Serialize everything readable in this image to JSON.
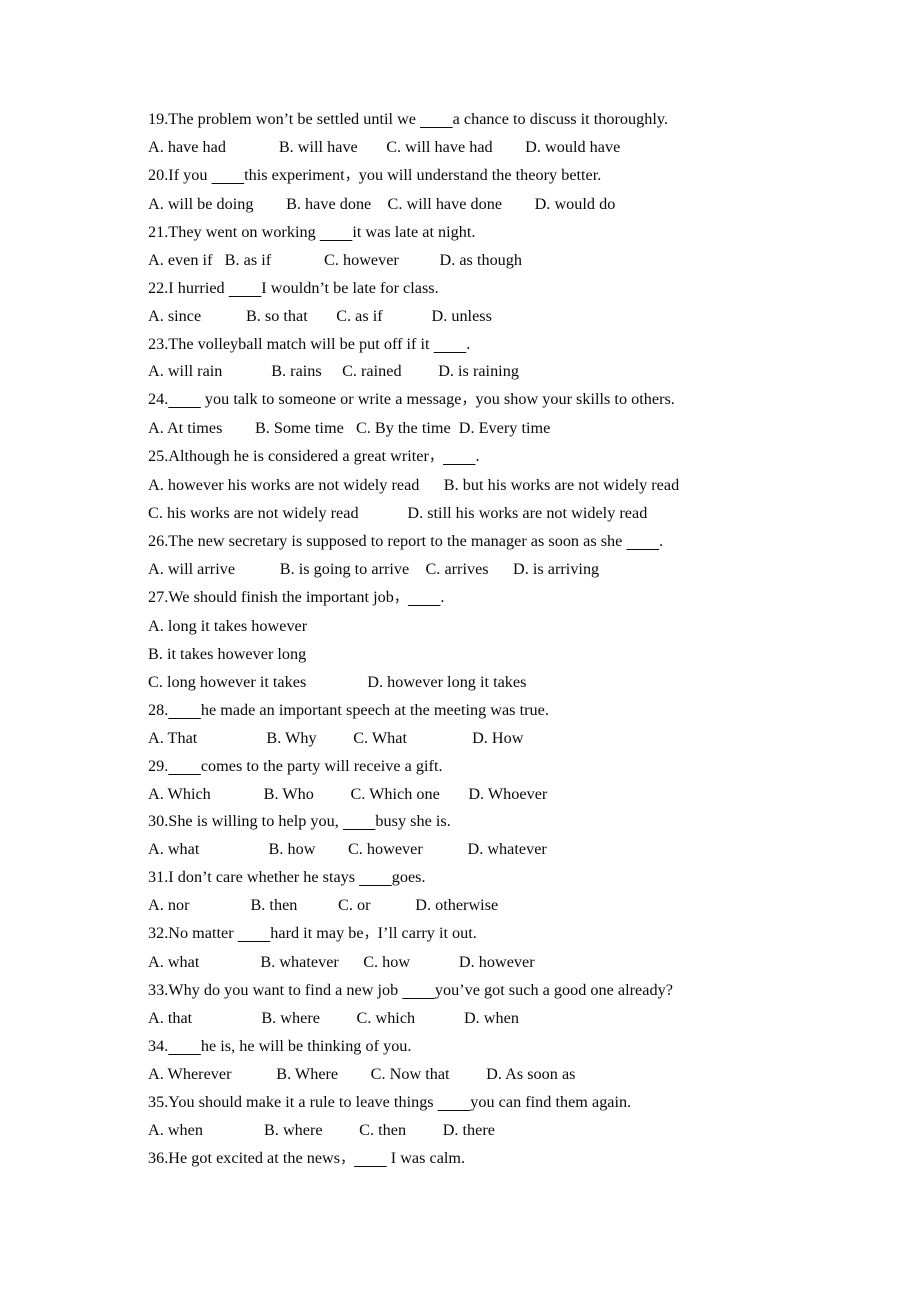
{
  "document": {
    "type": "grammar-multiple-choice-worksheet",
    "blank": "________",
    "lines": [
      {
        "id": "q19",
        "kind": "stem",
        "text": "19.The problem won’t be settled until we ________a chance to discuss it thoroughly."
      },
      {
        "id": "q19o",
        "kind": "options",
        "text": "A. have had             B. will have       C. will have had        D. would have"
      },
      {
        "id": "q20",
        "kind": "stem",
        "text": "20.If you ________this experiment，you will understand the theory better."
      },
      {
        "id": "q20o",
        "kind": "options",
        "text": "A. will be doing        B. have done    C. will have done        D. would do"
      },
      {
        "id": "q21",
        "kind": "stem",
        "text": "21.They went on working ________it was late at night."
      },
      {
        "id": "q21o",
        "kind": "options",
        "text": "A. even if   B. as if             C. however          D. as though"
      },
      {
        "id": "q22",
        "kind": "stem",
        "text": "22.I hurried ________I wouldn’t be late for class."
      },
      {
        "id": "q22o",
        "kind": "options",
        "text": "A. since           B. so that       C. as if            D. unless"
      },
      {
        "id": "q23",
        "kind": "stem",
        "text": "23.The volleyball match will be put off if it ________."
      },
      {
        "id": "q23o",
        "kind": "options",
        "text": "A. will rain            B. rains     C. rained         D. is raining"
      },
      {
        "id": "q24",
        "kind": "stem",
        "text": "24.________ you talk to someone or write a message，you show your skills to others."
      },
      {
        "id": "q24o",
        "kind": "options",
        "text": "A. At times        B. Some time   C. By the time  D. Every time"
      },
      {
        "id": "q25",
        "kind": "stem",
        "text": "25.Although he is considered a great writer，________."
      },
      {
        "id": "q25oa",
        "kind": "options",
        "text": "A. however his works are not widely read      B. but his works are not widely read"
      },
      {
        "id": "q25ob",
        "kind": "options",
        "text": "C. his works are not widely read            D. still his works are not widely read"
      },
      {
        "id": "q26",
        "kind": "stem",
        "text": "26.The new secretary is supposed to report to the manager as soon as she ________."
      },
      {
        "id": "q26o",
        "kind": "options",
        "text": "A. will arrive           B. is going to arrive    C. arrives      D. is arriving"
      },
      {
        "id": "q27",
        "kind": "stem",
        "text": "27.We should finish the important job，________."
      },
      {
        "id": "q27oa",
        "kind": "options",
        "text": "A. long it takes however"
      },
      {
        "id": "q27ob",
        "kind": "options",
        "text": "B. it takes however long"
      },
      {
        "id": "q27oc",
        "kind": "options",
        "text": "C. long however it takes               D. however long it takes"
      },
      {
        "id": "q28",
        "kind": "stem",
        "text": "28.________he made an important speech at the meeting was true."
      },
      {
        "id": "q28o",
        "kind": "options",
        "text": "A. That                 B. Why         C. What                D. How"
      },
      {
        "id": "q29",
        "kind": "stem",
        "text": "29.________comes to the party will receive a gift."
      },
      {
        "id": "q29o",
        "kind": "options",
        "text": "A. Which             B. Who         C. Which one       D. Whoever"
      },
      {
        "id": "q30",
        "kind": "stem",
        "text": "30.She is willing to help you, ________busy she is."
      },
      {
        "id": "q30o",
        "kind": "options",
        "text": "A. what                 B. how        C. however           D. whatever"
      },
      {
        "id": "q31",
        "kind": "stem",
        "text": "31.I don’t care whether he stays ________goes."
      },
      {
        "id": "q31o",
        "kind": "options",
        "text": "A. nor               B. then          C. or           D. otherwise"
      },
      {
        "id": "q32",
        "kind": "stem",
        "text": "32.No matter ________hard it may be，I’ll carry it out."
      },
      {
        "id": "q32o",
        "kind": "options",
        "text": "A. what               B. whatever      C. how            D. however"
      },
      {
        "id": "q33",
        "kind": "stem",
        "text": "33.Why do you want to find a new job ________you’ve got such a good one already?"
      },
      {
        "id": "q33o",
        "kind": "options",
        "text": "A. that                 B. where         C. which            D. when"
      },
      {
        "id": "q34",
        "kind": "stem",
        "text": "34.________he is, he will be thinking of you."
      },
      {
        "id": "q34o",
        "kind": "options",
        "text": "A. Wherever           B. Where        C. Now that         D. As soon as"
      },
      {
        "id": "q35",
        "kind": "stem",
        "text": "35.You should make it a rule to leave things ________you can find them again."
      },
      {
        "id": "q35o",
        "kind": "options",
        "text": "A. when               B. where         C. then         D. there"
      },
      {
        "id": "q36",
        "kind": "stem",
        "text": "36.He got excited at the news，________ I was calm."
      }
    ]
  }
}
